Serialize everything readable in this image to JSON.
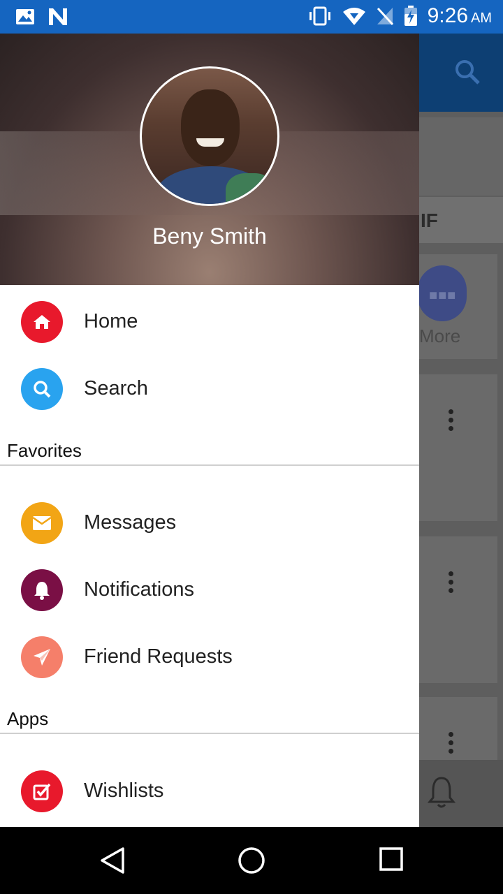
{
  "status_bar": {
    "time": "9:26",
    "ampm": "AM",
    "left_icons": [
      "image-icon",
      "n-app-icon"
    ],
    "right_icons": [
      "vibrate-icon",
      "wifi-icon",
      "no-sim-icon",
      "battery-charging-icon"
    ]
  },
  "drawer": {
    "profile": {
      "name": "Beny Smith"
    },
    "items": [
      {
        "label": "Home",
        "icon": "home-icon",
        "color": "#e8192c"
      },
      {
        "label": "Search",
        "icon": "search-icon",
        "color": "#29a3ef"
      }
    ],
    "favorites": {
      "title": "Favorites",
      "items": [
        {
          "label": "Messages",
          "icon": "envelope-icon",
          "color": "#f2a515"
        },
        {
          "label": "Notifications",
          "icon": "bell-icon",
          "color": "#7a0f45"
        },
        {
          "label": "Friend Requests",
          "icon": "paper-plane-icon",
          "color": "#f57f6a"
        }
      ]
    },
    "apps": {
      "title": "Apps",
      "items": [
        {
          "label": "Wishlists",
          "icon": "checkbox-icon",
          "color": "#e8192c"
        }
      ]
    }
  },
  "background": {
    "partial_tab": "IF",
    "more_label": "More"
  },
  "nav_bar": [
    "back-icon",
    "home-circle-icon",
    "recents-icon"
  ]
}
